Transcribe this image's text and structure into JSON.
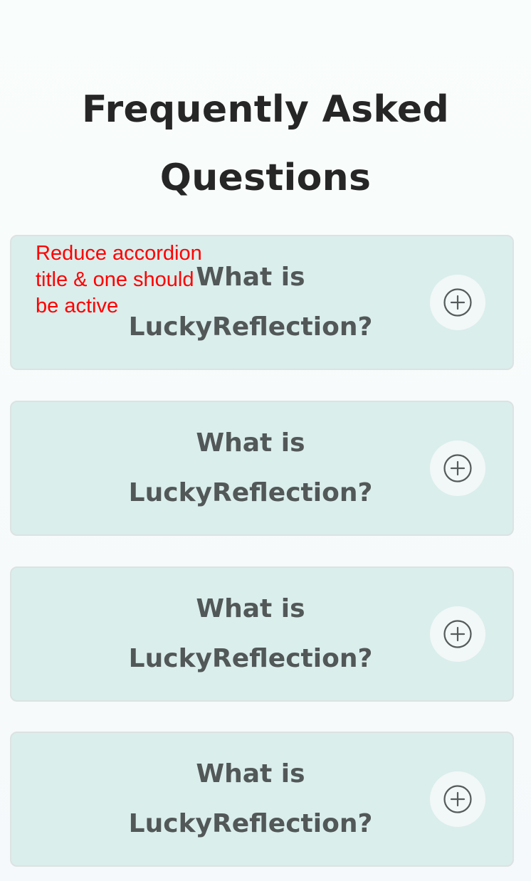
{
  "page": {
    "title_lines": [
      "Frequently Asked",
      "Questions"
    ]
  },
  "faq_items": [
    {
      "question_lines": [
        "What is",
        "LuckyReflection?"
      ],
      "toggle_icon": "plus-circle-icon"
    },
    {
      "question_lines": [
        "What is",
        "LuckyReflection?"
      ],
      "toggle_icon": "plus-circle-icon"
    },
    {
      "question_lines": [
        "What is",
        "LuckyReflection?"
      ],
      "toggle_icon": "plus-circle-icon"
    },
    {
      "question_lines": [
        "What is",
        "LuckyReflection?"
      ],
      "toggle_icon": "plus-circle-icon"
    }
  ],
  "review_note": {
    "lines": [
      "Reduce accordion",
      "title & one should",
      "be active"
    ],
    "color": "#ff0000"
  },
  "colors": {
    "accordion_background": "#daeeec",
    "accordion_border": "#dce2e2",
    "question_text": "#525757",
    "heading_text": "#262626",
    "icon_stroke": "#555b5b"
  }
}
